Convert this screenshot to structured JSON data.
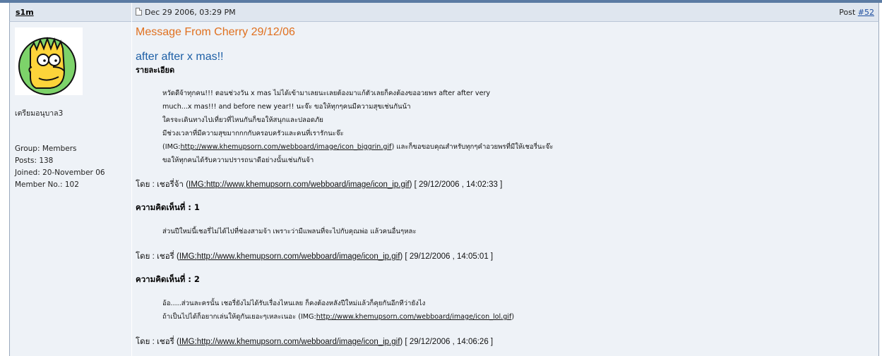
{
  "post": {
    "author": "s1m",
    "date": "Dec 29 2006, 03:29 PM",
    "post_label": "Post ",
    "post_number": "#52"
  },
  "user": {
    "title": "เตรียมอนุบาล3",
    "group": "Group: Members",
    "posts": "Posts: 138",
    "joined": "Joined: 20-November 06",
    "member_no": "Member No.: 102"
  },
  "message": {
    "title": "Message From Cherry 29/12/06",
    "subject": "after after x mas!!",
    "detail_label": "รายละเอียด",
    "body": [
      {
        "text": "หวัดดีจ้าทุกคน!!! ตอนช่วงวัน x mas ไม่ได้เข้ามาเลยนะเลยต้องมาแก้ตัวเลยก็คงต้องขออวยพร after after very",
        "link": ""
      },
      {
        "text": "much...x mas!!! and before new year!! นะจ๊ะ ขอให้ทุกๆคนมีความสุขเช่นกันน้า",
        "link": ""
      },
      {
        "text": "ใครจะเดินทางไปเที่ยวที่ไหนกันก็ขอให้สนุกและปลอดภัย",
        "link": ""
      },
      {
        "text": "มีช่วงเวลาที่มีความสุขมากกกกับครอบครัวและคนที่เรารักนะจ๊ะ",
        "link": ""
      },
      {
        "text": "(IMG:",
        "link": "http://www.khemupsorn.com/webboard/image/icon_biggrin.gif",
        "after": ") และก็ขอขอบคุณสำหรับทุกๆคำอวยพรที่มีให้เชอรี่นะจ๊ะ"
      },
      {
        "text": "ขอให้ทุกคนได้รับความปรารถนาดีอย่างนั้นเช่นกันจ้า",
        "link": ""
      }
    ],
    "byline_prefix": "โดย : เชอรี่จ้า ",
    "byline_img_label": "IMG:",
    "byline_link": "http://www.khemupsorn.com/webboard/image/icon_ip.gif",
    "byline_date": ") [ 29/12/2006 , 14:02:33 ]"
  },
  "comments": [
    {
      "heading": "ความคิดเห็นที่ : 1",
      "lines": [
        {
          "text": "ส่วนปีใหม่นี้เชอรี่ไม่ได้ไปที่ช่องสามจ้า เพราะว่ามีแพลนที่จะไปกับคุณพ่อ แล้วคนอื่นๆหละ",
          "link": ""
        }
      ],
      "byline_prefix": "โดย : เชอรี่ ",
      "byline_link": "http://www.khemupsorn.com/webboard/image/icon_ip.gif",
      "byline_date": ") [ 29/12/2006 , 14:05:01 ]"
    },
    {
      "heading": "ความคิดเห็นที่ : 2",
      "lines": [
        {
          "text": "อ้อ.....ส่วนละครนั้น เชอรี่ยังไม่ได้รับเรื่องไหนเลย ก็คงต้องหลังปีใหม่แล้วก็คุยกันอีกทีว่ายังไง",
          "link": ""
        },
        {
          "text": "ถ้าเป็นไปได้ก็อยากเล่นให้ดูกันเยอะๆเหละเนอะ (IMG:",
          "link": "http://www.khemupsorn.com/webboard/image/icon_lol.gif",
          "after": ")"
        }
      ],
      "byline_prefix": "โดย : เชอรี่ ",
      "byline_link": "http://www.khemupsorn.com/webboard/image/icon_ip.gif",
      "byline_date": ") [ 29/12/2006 , 14:06:26 ]"
    }
  ],
  "colors": {
    "header_bg": "#dfe6ef",
    "body_bg": "#eef2f7",
    "title_orange": "#e0701f",
    "subject_blue": "#1d5fa6"
  },
  "icons": [
    "page-icon",
    "avatar-bart"
  ]
}
